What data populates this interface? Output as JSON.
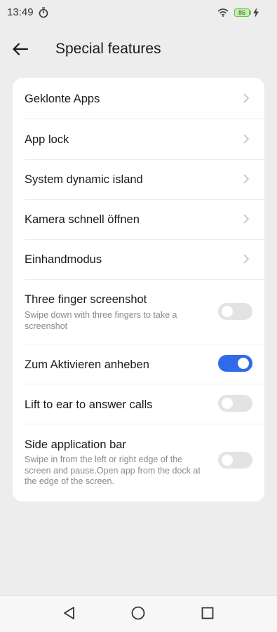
{
  "status_bar": {
    "time": "13:49",
    "battery_level": "86",
    "icons": [
      "timer-icon",
      "wifi-icon",
      "battery-icon",
      "charging-bolt-icon"
    ]
  },
  "header": {
    "title": "Special features",
    "back_icon": "arrow-left-icon"
  },
  "items": [
    {
      "title": "Geklonte Apps",
      "type": "link"
    },
    {
      "title": "App lock",
      "type": "link"
    },
    {
      "title": "System dynamic island",
      "type": "link"
    },
    {
      "title": "Kamera schnell öffnen",
      "type": "link"
    },
    {
      "title": "Einhandmodus",
      "type": "link"
    },
    {
      "title": "Three finger screenshot",
      "subtitle": "Swipe down with three fingers to take a screenshot",
      "type": "toggle",
      "enabled": false
    },
    {
      "title": "Zum Aktivieren anheben",
      "type": "toggle",
      "enabled": true
    },
    {
      "title": "Lift to ear to answer calls",
      "type": "toggle",
      "enabled": false
    },
    {
      "title": "Side application bar",
      "subtitle": "Swipe in from the left or right edge of the screen and pause.Open app from the dock at the edge of the screen.",
      "type": "toggle",
      "enabled": false
    }
  ],
  "colors": {
    "accent": "#2f6bea",
    "background": "#ededed",
    "card": "#ffffff",
    "toggle_off": "#e3e3e3",
    "battery": "#6dbf4a"
  },
  "nav_bar": {
    "icons": [
      "back-triangle-icon",
      "home-circle-icon",
      "recents-square-icon"
    ]
  }
}
